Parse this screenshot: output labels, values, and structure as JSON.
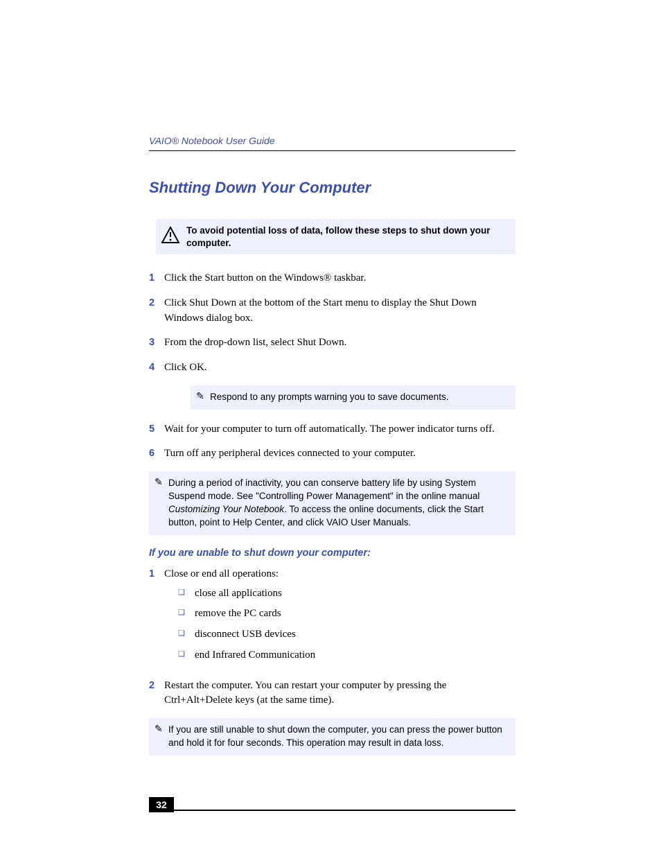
{
  "guideTitle": "VAIO® Notebook User Guide",
  "heading": "Shutting Down Your Computer",
  "warningText": "To avoid potential loss of data, follow these steps to shut down your computer.",
  "steps": {
    "s1": "Click the Start button on the Windows® taskbar.",
    "s2": "Click Shut Down at the bottom of the Start menu to display the Shut Down Windows dialog box.",
    "s3": "From the drop-down list, select Shut Down.",
    "s4": "Click OK.",
    "s5": "Wait for your computer to turn off automatically. The power indicator turns off.",
    "s6": "Turn off any peripheral devices connected to your computer."
  },
  "noteAfter4": "Respond to any prompts warning you to save documents.",
  "noteAfter6_a": "During a period of inactivity, you can conserve battery life by using System Suspend mode. See \"Controlling Power Management\"  in the online manual ",
  "noteAfter6_i": "Customizing Your Notebook",
  "noteAfter6_b": ". To access the online documents, click the Start button, point to Help Center, and click VAIO User Manuals.",
  "subHeading": "If you are unable to shut down your computer:",
  "unable": {
    "u1": "Close or end all operations:",
    "u1a": "close all applications",
    "u1b": "remove the PC cards",
    "u1c": "disconnect USB devices",
    "u1d": "end Infrared Communication",
    "u2": "Restart the computer. You can restart your computer by pressing the Ctrl+Alt+Delete keys (at the same time)."
  },
  "finalNote": "If you are still unable to shut down the computer, you can press the power button and hold it for four seconds. This operation may result in data loss.",
  "pageNumber": "32",
  "nums": {
    "n1": "1",
    "n2": "2",
    "n3": "3",
    "n4": "4",
    "n5": "5",
    "n6": "6"
  }
}
